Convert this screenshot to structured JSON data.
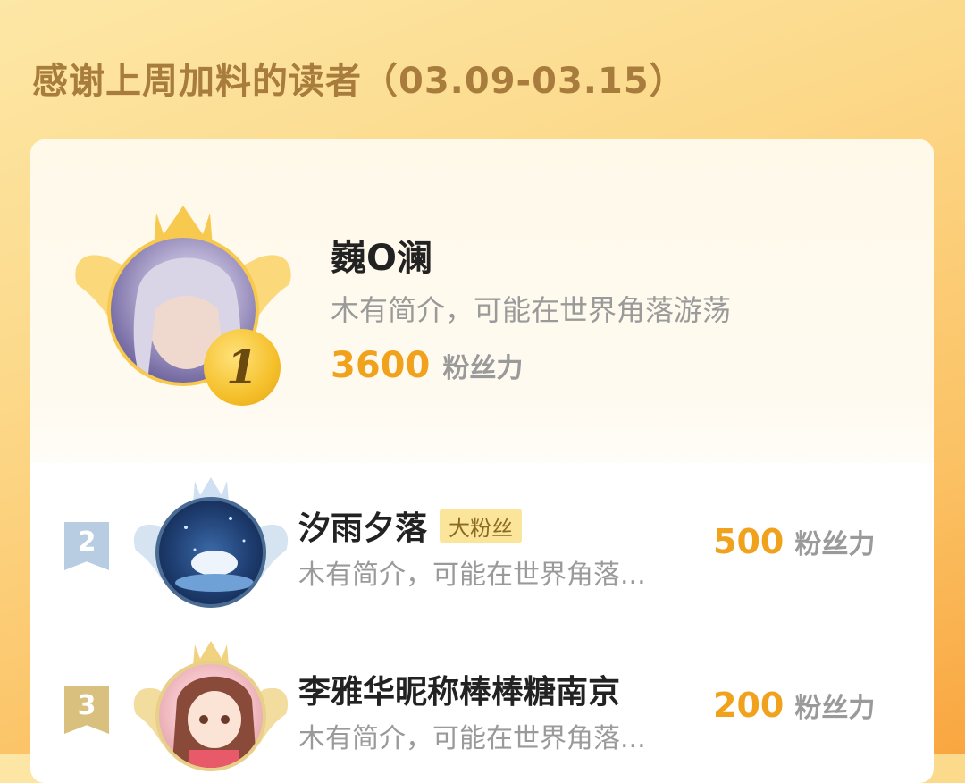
{
  "header": {
    "title": "感谢上周加料的读者（03.09-03.15）"
  },
  "readers": [
    {
      "rank": "1",
      "name": "巍O澜",
      "bio": "木有简介，可能在世界角落游荡",
      "score": "3600",
      "unit": "粉丝力",
      "tag": ""
    },
    {
      "rank": "2",
      "name": "汐雨夕落",
      "bio": "木有简介，可能在世界角落...",
      "score": "500",
      "unit": "粉丝力",
      "tag": "大粉丝"
    },
    {
      "rank": "3",
      "name": "李雅华昵称棒棒糖南京",
      "bio": "木有简介，可能在世界角落...",
      "score": "200",
      "unit": "粉丝力",
      "tag": ""
    }
  ],
  "colors": {
    "accent": "#f0a21d",
    "gold": "#f5c02b",
    "title": "#a87c3d"
  }
}
